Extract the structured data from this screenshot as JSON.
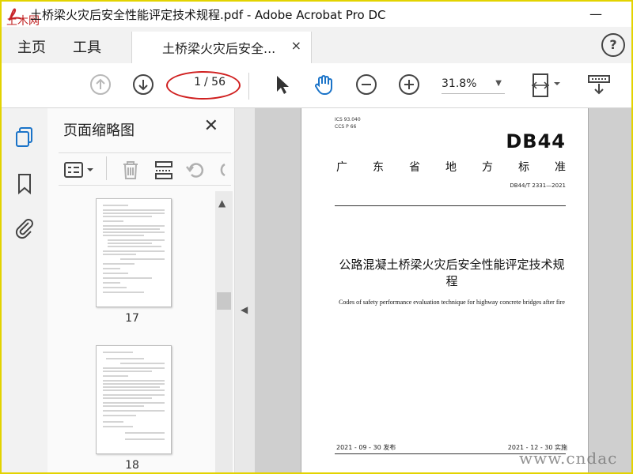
{
  "window": {
    "title": "土桥梁火灾后安全性能评定技术规程.pdf - Adobe Acrobat Pro DC",
    "app_watermark": "土木网"
  },
  "tabs": {
    "home": "主页",
    "tools": "工具",
    "doc_tab": "土桥梁火灾后安全...",
    "close": "×"
  },
  "toolbar": {
    "page_current": "1",
    "page_total": "/ 56",
    "zoom": "31.8%"
  },
  "panel": {
    "title": "页面缩略图",
    "close": "✕",
    "thumbnails": [
      {
        "label": "17"
      },
      {
        "label": "18"
      }
    ]
  },
  "document": {
    "ics_line": "ICS  93.040",
    "ccs_line": "CCS  P 66",
    "logo": "DB44",
    "standard_chars": [
      "广",
      "东",
      "省",
      "地",
      "方",
      "标",
      "准"
    ],
    "standard_no": "DB44/T 2331—2021",
    "title_cn": "公路混凝土桥梁火灾后安全性能评定技术规程",
    "title_en": "Codes of safety performance evaluation technique for highway concrete bridges after fire",
    "issue_date": "2021 - 09 - 30 发布",
    "impl_date": "2021 - 12 - 30 实施"
  },
  "watermark": "www.cndac",
  "colors": {
    "accent": "#1a73c8",
    "annotation_red": "#d02020",
    "frame_yellow": "#e3d300"
  }
}
